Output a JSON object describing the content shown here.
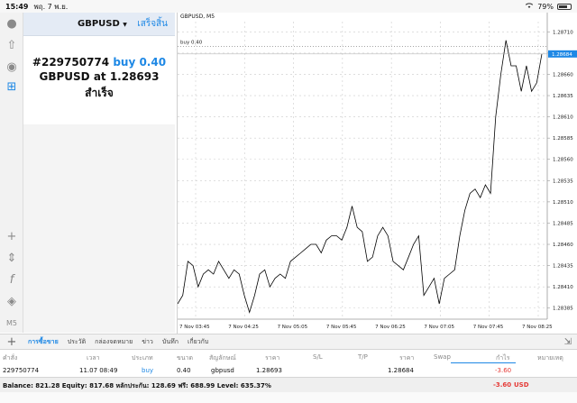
{
  "status_bar": {
    "time": "15:49",
    "date": "พฤ. 7 พ.ย.",
    "battery": "79%",
    "battery_level": 0.79,
    "wifi_icon": "wifi-icon"
  },
  "toolbar": {
    "icons": [
      "account-icon",
      "trade-icon",
      "chat-icon",
      "new-order-icon",
      "crosshair-icon",
      "indicators-icon",
      "function-icon",
      "objects-icon",
      "timeframe-icon"
    ],
    "timeframe_label": "M5"
  },
  "order_panel": {
    "symbol": "GBPUSD",
    "done_label": "เสร็จสิ้น",
    "order_id": "#229750774",
    "action": "buy 0.40",
    "line2": "GBPUSD at 1.28693",
    "status": "สำเร็จ"
  },
  "chart": {
    "title": "GBPUSD, M5",
    "buy_line_label": "buy 0.40",
    "current_price": "1.28684",
    "colors": {
      "line": "#000000",
      "grid": "#cccccc",
      "price_tag": "#1e88e5"
    }
  },
  "chart_data": {
    "type": "line",
    "title": "GBPUSD, M5",
    "x_ticks": [
      "7 Nov 03:45",
      "7 Nov 04:25",
      "7 Nov 05:05",
      "7 Nov 05:45",
      "7 Nov 06:25",
      "7 Nov 07:05",
      "7 Nov 07:45",
      "7 Nov 08:25"
    ],
    "y_ticks": [
      "1.28710",
      "1.28685",
      "1.28660",
      "1.28635",
      "1.28610",
      "1.28585",
      "1.28560",
      "1.28535",
      "1.28510",
      "1.28485",
      "1.28460",
      "1.28435",
      "1.28410",
      "1.28385"
    ],
    "ylim": [
      1.28372,
      1.28722
    ],
    "grid": true,
    "buy_line": 1.28693,
    "series": [
      {
        "values": [
          1.2839,
          1.284,
          1.2844,
          1.28435,
          1.2841,
          1.28425,
          1.2843,
          1.28425,
          1.2844,
          1.2843,
          1.2842,
          1.2843,
          1.28425,
          1.284,
          1.2838,
          1.284,
          1.28425,
          1.2843,
          1.2841,
          1.2842,
          1.28425,
          1.2842,
          1.2844,
          1.28445,
          1.2845,
          1.28455,
          1.2846,
          1.2846,
          1.2845,
          1.28465,
          1.2847,
          1.2847,
          1.28465,
          1.2848,
          1.28505,
          1.2848,
          1.28475,
          1.2844,
          1.28445,
          1.2847,
          1.2848,
          1.2847,
          1.2844,
          1.28435,
          1.2843,
          1.28445,
          1.2846,
          1.2847,
          1.284,
          1.2841,
          1.2842,
          1.2839,
          1.2842,
          1.28425,
          1.2843,
          1.2847,
          1.285,
          1.2852,
          1.28525,
          1.28515,
          1.2853,
          1.2852,
          1.2861,
          1.2866,
          1.287,
          1.2867,
          1.2867,
          1.2864,
          1.2867,
          1.2864,
          1.2865,
          1.28684
        ]
      }
    ]
  },
  "tabs": {
    "add_icon": "plus-icon",
    "items": [
      "การซื้อขาย",
      "ประวัติ",
      "กล่องจดหมาย",
      "ข่าว",
      "บันทึก",
      "เกี่ยวกับ"
    ],
    "active_index": 0,
    "corner_icon": "expand-icon"
  },
  "table": {
    "headers": [
      "คำสั่ง",
      "เวลา",
      "ประเภท",
      "ขนาด",
      "สัญลักษณ์",
      "ราคา",
      "S/L",
      "T/P",
      "ราคา",
      "Swap",
      "กำไร",
      "หมายเหตุ"
    ],
    "rows": [
      {
        "order": "229750774",
        "time": "11.07 08:49",
        "type": "buy",
        "size": "0.40",
        "symbol": "gbpusd",
        "price": "1.28693",
        "sl": "",
        "tp": "",
        "price2": "1.28684",
        "swap": "",
        "profit": "-3.60",
        "comment": ""
      }
    ]
  },
  "balance": {
    "text": "Balance: 821.28 Equity: 817.68 หลักประกัน: 128.69 ฟรี: 688.99 Level: 635.37%",
    "total": "-3.60",
    "currency": "USD"
  }
}
